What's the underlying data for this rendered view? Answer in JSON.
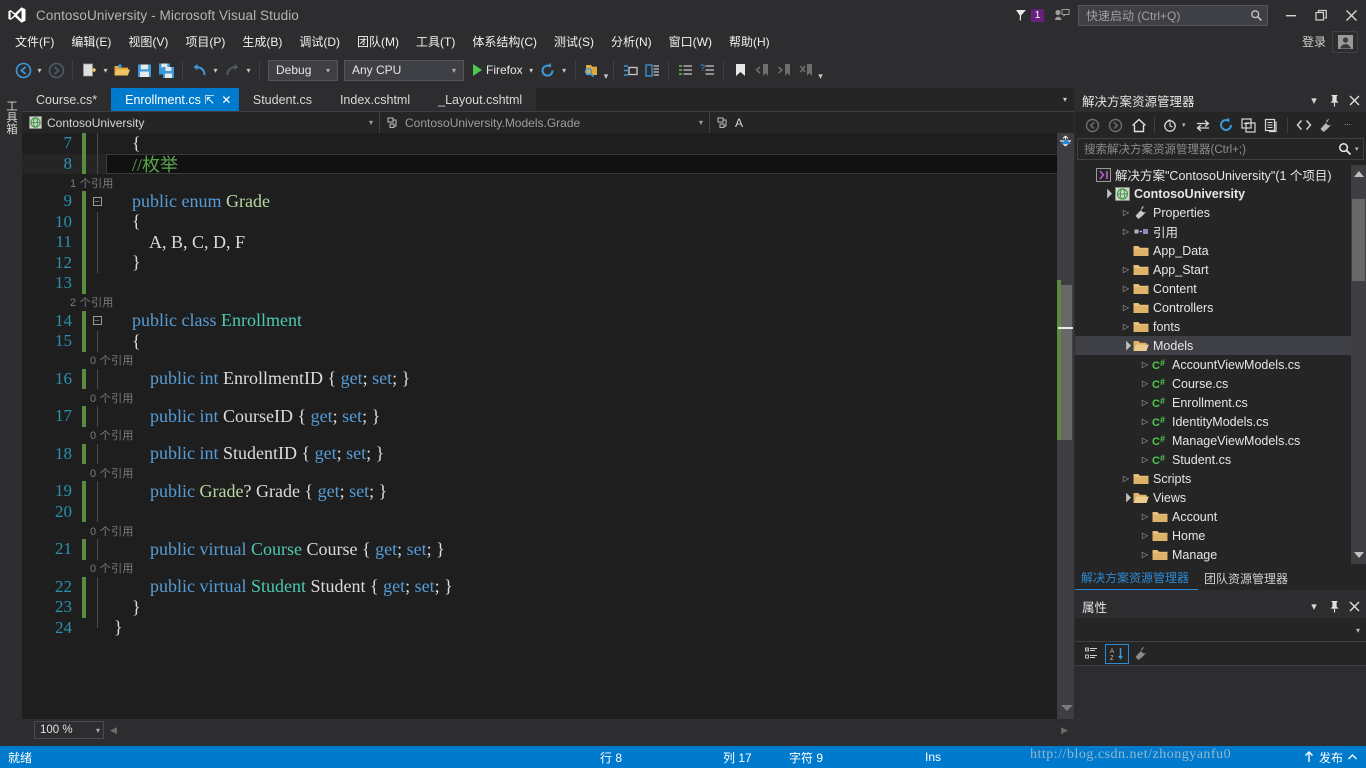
{
  "window": {
    "title": "ContosoUniversity - Microsoft Visual Studio",
    "logo_icon": "visual-studio-logo",
    "minimize_label": "–",
    "maximize_label": "❐",
    "close_label": "✕",
    "notification_count": "1",
    "notification_icon": "flag-icon",
    "feedback_icon": "feedback-icon",
    "signin_label": "登录",
    "account_icon": "account-icon"
  },
  "quick_launch": {
    "placeholder": "快速启动 (Ctrl+Q)",
    "icon": "search-icon"
  },
  "menubar": {
    "items": [
      {
        "label": "文件(F)"
      },
      {
        "label": "编辑(E)"
      },
      {
        "label": "视图(V)"
      },
      {
        "label": "项目(P)"
      },
      {
        "label": "生成(B)"
      },
      {
        "label": "调试(D)"
      },
      {
        "label": "团队(M)"
      },
      {
        "label": "工具(T)"
      },
      {
        "label": "体系结构(C)"
      },
      {
        "label": "测试(S)"
      },
      {
        "label": "分析(N)"
      },
      {
        "label": "窗口(W)"
      },
      {
        "label": "帮助(H)"
      }
    ]
  },
  "toolbar": {
    "back_icon": "navigate-back-icon",
    "forward_icon": "navigate-forward-icon",
    "newproject_icon": "new-project-icon",
    "openfile_icon": "open-file-icon",
    "save_icon": "save-icon",
    "saveall_icon": "save-all-icon",
    "undo_icon": "undo-icon",
    "redo_icon": "redo-icon",
    "config_value": "Debug",
    "platform_value": "Any CPU",
    "run_label": "Firefox",
    "run_icon": "play-icon",
    "refresh_icon": "refresh-icon",
    "findinfiles_icon": "find-in-files-icon",
    "stepinto_icon": "step-into-icon",
    "stepover_icon": "step-over-icon",
    "indent1_icon": "comment-selection-icon",
    "indent2_icon": "uncomment-selection-icon",
    "bookmark_icon": "bookmark-icon",
    "bm_prev_icon": "previous-bookmark-icon",
    "bm_next_icon": "next-bookmark-icon",
    "bm_clear_icon": "clear-bookmarks-icon",
    "overflow_label": "▾"
  },
  "toolbox_tab": {
    "label": "工具箱"
  },
  "editor": {
    "tabs": [
      {
        "label": "Course.cs*",
        "active": false
      },
      {
        "label": "Enrollment.cs",
        "active": true,
        "pin_icon": "pin-icon",
        "close_icon": "close-icon"
      },
      {
        "label": "Student.cs",
        "active": false
      },
      {
        "label": "Index.cshtml",
        "active": false
      },
      {
        "label": "_Layout.cshtml",
        "active": false
      }
    ],
    "tab_overflow_icon": "chevron-down-icon",
    "navbar": {
      "project": "ContosoUniversity",
      "project_icon": "project-icon",
      "type": "ContosoUniversity.Models.Grade",
      "type_icon": "enum-icon",
      "member": "A",
      "member_icon": "member-icon"
    },
    "zoom_level": "100 %",
    "lines": [
      {
        "num": "7",
        "changed": true,
        "fold": "line",
        "current": false,
        "tokens": [
          {
            "t": "    {",
            "c": "pln"
          }
        ]
      },
      {
        "num": "8",
        "changed": true,
        "fold": "line",
        "current": true,
        "tokens": [
          {
            "t": "    ",
            "c": "pln"
          },
          {
            "t": "//枚举",
            "c": "cmt"
          }
        ]
      },
      {
        "num": "",
        "codelens": "1 个引用",
        "indent": 42
      },
      {
        "num": "9",
        "changed": true,
        "fold": "box",
        "current": false,
        "tokens": [
          {
            "t": "    ",
            "c": "pln"
          },
          {
            "t": "public enum ",
            "c": "kw"
          },
          {
            "t": "Grade",
            "c": "enm"
          }
        ]
      },
      {
        "num": "10",
        "changed": true,
        "fold": "line",
        "current": false,
        "tokens": [
          {
            "t": "    {",
            "c": "pln"
          }
        ]
      },
      {
        "num": "11",
        "changed": true,
        "fold": "line",
        "current": false,
        "tokens": [
          {
            "t": "        A, B, C, D, F",
            "c": "pln"
          }
        ]
      },
      {
        "num": "12",
        "changed": true,
        "fold": "line",
        "current": false,
        "tokens": [
          {
            "t": "    }",
            "c": "pln"
          }
        ]
      },
      {
        "num": "13",
        "changed": true,
        "fold": "none",
        "current": false,
        "tokens": [
          {
            "t": "",
            "c": "pln"
          }
        ]
      },
      {
        "num": "",
        "codelens": "2 个引用",
        "indent": 42
      },
      {
        "num": "14",
        "changed": true,
        "fold": "box",
        "current": false,
        "tokens": [
          {
            "t": "    ",
            "c": "pln"
          },
          {
            "t": "public class ",
            "c": "kw"
          },
          {
            "t": "Enrollment",
            "c": "type"
          }
        ]
      },
      {
        "num": "15",
        "changed": true,
        "fold": "line",
        "current": false,
        "tokens": [
          {
            "t": "    {",
            "c": "pln"
          }
        ]
      },
      {
        "num": "",
        "codelens": "0 个引用",
        "indent": 62
      },
      {
        "num": "16",
        "changed": true,
        "fold": "line",
        "current": false,
        "tokens": [
          {
            "t": "        ",
            "c": "pln"
          },
          {
            "t": "public int ",
            "c": "kw"
          },
          {
            "t": "EnrollmentID { ",
            "c": "pln"
          },
          {
            "t": "get",
            "c": "kw"
          },
          {
            "t": "; ",
            "c": "pln"
          },
          {
            "t": "set",
            "c": "kw"
          },
          {
            "t": "; }",
            "c": "pln"
          }
        ]
      },
      {
        "num": "",
        "codelens": "0 个引用",
        "indent": 62
      },
      {
        "num": "17",
        "changed": true,
        "fold": "line",
        "current": false,
        "tokens": [
          {
            "t": "        ",
            "c": "pln"
          },
          {
            "t": "public int ",
            "c": "kw"
          },
          {
            "t": "CourseID { ",
            "c": "pln"
          },
          {
            "t": "get",
            "c": "kw"
          },
          {
            "t": "; ",
            "c": "pln"
          },
          {
            "t": "set",
            "c": "kw"
          },
          {
            "t": "; }",
            "c": "pln"
          }
        ]
      },
      {
        "num": "",
        "codelens": "0 个引用",
        "indent": 62
      },
      {
        "num": "18",
        "changed": true,
        "fold": "line",
        "current": false,
        "tokens": [
          {
            "t": "        ",
            "c": "pln"
          },
          {
            "t": "public int ",
            "c": "kw"
          },
          {
            "t": "StudentID { ",
            "c": "pln"
          },
          {
            "t": "get",
            "c": "kw"
          },
          {
            "t": "; ",
            "c": "pln"
          },
          {
            "t": "set",
            "c": "kw"
          },
          {
            "t": "; }",
            "c": "pln"
          }
        ]
      },
      {
        "num": "",
        "codelens": "0 个引用",
        "indent": 62
      },
      {
        "num": "19",
        "changed": true,
        "fold": "line",
        "current": false,
        "tokens": [
          {
            "t": "        ",
            "c": "pln"
          },
          {
            "t": "public ",
            "c": "kw"
          },
          {
            "t": "Grade",
            "c": "enm"
          },
          {
            "t": "? Grade { ",
            "c": "pln"
          },
          {
            "t": "get",
            "c": "kw"
          },
          {
            "t": "; ",
            "c": "pln"
          },
          {
            "t": "set",
            "c": "kw"
          },
          {
            "t": "; }",
            "c": "pln"
          }
        ]
      },
      {
        "num": "20",
        "changed": true,
        "fold": "line",
        "current": false,
        "tokens": [
          {
            "t": "",
            "c": "pln"
          }
        ]
      },
      {
        "num": "",
        "codelens": "0 个引用",
        "indent": 62
      },
      {
        "num": "21",
        "changed": true,
        "fold": "line",
        "current": false,
        "tokens": [
          {
            "t": "        ",
            "c": "pln"
          },
          {
            "t": "public virtual ",
            "c": "kw"
          },
          {
            "t": "Course",
            "c": "type"
          },
          {
            "t": " Course { ",
            "c": "pln"
          },
          {
            "t": "get",
            "c": "kw"
          },
          {
            "t": "; ",
            "c": "pln"
          },
          {
            "t": "set",
            "c": "kw"
          },
          {
            "t": "; }",
            "c": "pln"
          }
        ]
      },
      {
        "num": "",
        "codelens": "0 个引用",
        "indent": 62
      },
      {
        "num": "22",
        "changed": true,
        "fold": "line",
        "current": false,
        "tokens": [
          {
            "t": "        ",
            "c": "pln"
          },
          {
            "t": "public virtual ",
            "c": "kw"
          },
          {
            "t": "Student",
            "c": "type"
          },
          {
            "t": " Student { ",
            "c": "pln"
          },
          {
            "t": "get",
            "c": "kw"
          },
          {
            "t": "; ",
            "c": "pln"
          },
          {
            "t": "set",
            "c": "kw"
          },
          {
            "t": "; }",
            "c": "pln"
          }
        ]
      },
      {
        "num": "23",
        "changed": true,
        "fold": "line",
        "current": false,
        "tokens": [
          {
            "t": "    }",
            "c": "pln"
          }
        ]
      },
      {
        "num": "24",
        "changed": false,
        "fold": "endline",
        "current": false,
        "tokens": [
          {
            "t": "}",
            "c": "pln"
          }
        ]
      }
    ]
  },
  "solution_explorer": {
    "title": "解决方案资源管理器",
    "menu_icon": "chevron-down-icon",
    "pin_icon": "pin-icon",
    "close_icon": "close-icon",
    "toolbar": {
      "back_icon": "back-icon",
      "forward_icon": "forward-icon",
      "home_icon": "home-icon",
      "pending_icon": "pending-changes-icon",
      "sync_icon": "sync-with-active-document-icon",
      "refresh_icon": "refresh-icon",
      "collapse_icon": "collapse-all-icon",
      "properties_icon": "show-all-files-icon",
      "code_icon": "view-code-icon",
      "wrench_icon": "properties-icon",
      "overflow_icon": "overflow-icon"
    },
    "search_placeholder": "搜索解决方案资源管理器(Ctrl+;)",
    "search_icon": "search-icon",
    "tree": [
      {
        "label": "解决方案\"ContosoUniversity\"(1 个项目)",
        "indent": 0,
        "expander": "",
        "icon": "solution-icon",
        "bold": false,
        "selected": false
      },
      {
        "label": "ContosoUniversity",
        "indent": 1,
        "expander": "▾",
        "icon": "web-project-icon",
        "bold": true,
        "selected": false
      },
      {
        "label": "Properties",
        "indent": 2,
        "expander": "▸",
        "icon": "wrench-icon",
        "bold": false,
        "selected": false
      },
      {
        "label": "引用",
        "indent": 2,
        "expander": "▸",
        "icon": "references-icon",
        "bold": false,
        "selected": false
      },
      {
        "label": "App_Data",
        "indent": 2,
        "expander": "",
        "icon": "folder-icon",
        "bold": false,
        "selected": false
      },
      {
        "label": "App_Start",
        "indent": 2,
        "expander": "▸",
        "icon": "folder-icon",
        "bold": false,
        "selected": false
      },
      {
        "label": "Content",
        "indent": 2,
        "expander": "▸",
        "icon": "folder-icon",
        "bold": false,
        "selected": false
      },
      {
        "label": "Controllers",
        "indent": 2,
        "expander": "▸",
        "icon": "folder-icon",
        "bold": false,
        "selected": false
      },
      {
        "label": "fonts",
        "indent": 2,
        "expander": "▸",
        "icon": "folder-icon",
        "bold": false,
        "selected": false
      },
      {
        "label": "Models",
        "indent": 2,
        "expander": "▾",
        "icon": "folder-open-icon",
        "bold": false,
        "selected": true
      },
      {
        "label": "AccountViewModels.cs",
        "indent": 3,
        "expander": "▸",
        "icon": "csharp-file-icon",
        "bold": false,
        "selected": false
      },
      {
        "label": "Course.cs",
        "indent": 3,
        "expander": "▸",
        "icon": "csharp-file-icon",
        "bold": false,
        "selected": false
      },
      {
        "label": "Enrollment.cs",
        "indent": 3,
        "expander": "▸",
        "icon": "csharp-file-icon",
        "bold": false,
        "selected": false
      },
      {
        "label": "IdentityModels.cs",
        "indent": 3,
        "expander": "▸",
        "icon": "csharp-file-icon",
        "bold": false,
        "selected": false
      },
      {
        "label": "ManageViewModels.cs",
        "indent": 3,
        "expander": "▸",
        "icon": "csharp-file-icon",
        "bold": false,
        "selected": false
      },
      {
        "label": "Student.cs",
        "indent": 3,
        "expander": "▸",
        "icon": "csharp-file-icon",
        "bold": false,
        "selected": false
      },
      {
        "label": "Scripts",
        "indent": 2,
        "expander": "▸",
        "icon": "folder-icon",
        "bold": false,
        "selected": false
      },
      {
        "label": "Views",
        "indent": 2,
        "expander": "▾",
        "icon": "folder-open-icon",
        "bold": false,
        "selected": false
      },
      {
        "label": "Account",
        "indent": 3,
        "expander": "▸",
        "icon": "folder-icon",
        "bold": false,
        "selected": false
      },
      {
        "label": "Home",
        "indent": 3,
        "expander": "▸",
        "icon": "folder-icon",
        "bold": false,
        "selected": false
      },
      {
        "label": "Manage",
        "indent": 3,
        "expander": "▸",
        "icon": "folder-icon",
        "bold": false,
        "selected": false
      }
    ],
    "dock_tabs": [
      {
        "label": "解决方案资源管理器",
        "active": true
      },
      {
        "label": "团队资源管理器",
        "active": false
      }
    ]
  },
  "properties_panel": {
    "title": "属性",
    "menu_icon": "chevron-down-icon",
    "pin_icon": "pin-icon",
    "close_icon": "close-icon",
    "object_value": "",
    "categorized_icon": "categorized-view-icon",
    "alphabetical_icon": "alphabetical-sort-icon",
    "properties_icon": "property-pages-icon"
  },
  "statusbar": {
    "ready": "就绪",
    "line_label": "行 8",
    "col_label": "列 17",
    "char_label": "字符 9",
    "insert_mode": "Ins",
    "publish_label": "发布",
    "publish_icon": "publish-icon"
  },
  "watermark": {
    "text": "http://blog.csdn.net/zhongyanfu0"
  },
  "colors": {
    "accent": "#007acc",
    "titlebar_bg": "#2d2d30",
    "editor_bg": "#1e1e1e",
    "panel_bg": "#252526",
    "badge_purple": "#68217a",
    "keyword": "#569cd6",
    "type": "#4ec9b0",
    "enum": "#b8d7a3",
    "comment": "#57a64a",
    "linenum": "#2b91af",
    "changebar_green": "#5a8b3e"
  }
}
